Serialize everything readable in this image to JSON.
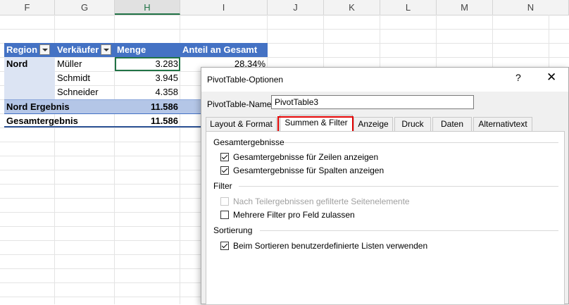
{
  "sheet": {
    "columns": [
      "F",
      "G",
      "H",
      "I",
      "J",
      "K",
      "L",
      "M",
      "N"
    ],
    "active_column": "H"
  },
  "pivot": {
    "headers": [
      "Region",
      "Verkäufer",
      "Menge",
      "Anteil an Gesamt"
    ],
    "rows": [
      {
        "region": "Nord",
        "seller": "Müller",
        "qty": "3.283",
        "share": "28,34%"
      },
      {
        "region": "",
        "seller": "Schmidt",
        "qty": "3.945",
        "share": ""
      },
      {
        "region": "",
        "seller": "Schneider",
        "qty": "4.358",
        "share": ""
      }
    ],
    "subtotal": {
      "label": "Nord Ergebnis",
      "qty": "11.586"
    },
    "grand": {
      "label": "Gesamtergebnis",
      "qty": "11.586"
    }
  },
  "dialog": {
    "title": "PivotTable-Optionen",
    "help": "?",
    "close": "✕",
    "name_label": "PivotTable-Name:",
    "name_value": "PivotTable3",
    "tabs": [
      "Layout & Format",
      "Summen & Filter",
      "Anzeige",
      "Druck",
      "Daten",
      "Alternativtext"
    ],
    "active_tab": "Summen & Filter",
    "groups": {
      "totals": {
        "title": "Gesamtergebnisse",
        "options": [
          {
            "label": "Gesamtergebnisse für Zeilen anzeigen",
            "checked": true
          },
          {
            "label": "Gesamtergebnisse für Spalten anzeigen",
            "checked": true
          }
        ]
      },
      "filter": {
        "title": "Filter",
        "options": [
          {
            "label": "Nach Teilergebnissen gefilterte Seitenelemente",
            "checked": false,
            "disabled": true
          },
          {
            "label": "Mehrere Filter pro Feld zulassen",
            "checked": false
          }
        ]
      },
      "sort": {
        "title": "Sortierung",
        "options": [
          {
            "label": "Beim Sortieren benutzerdefinierte Listen verwenden",
            "checked": true
          }
        ]
      }
    }
  }
}
